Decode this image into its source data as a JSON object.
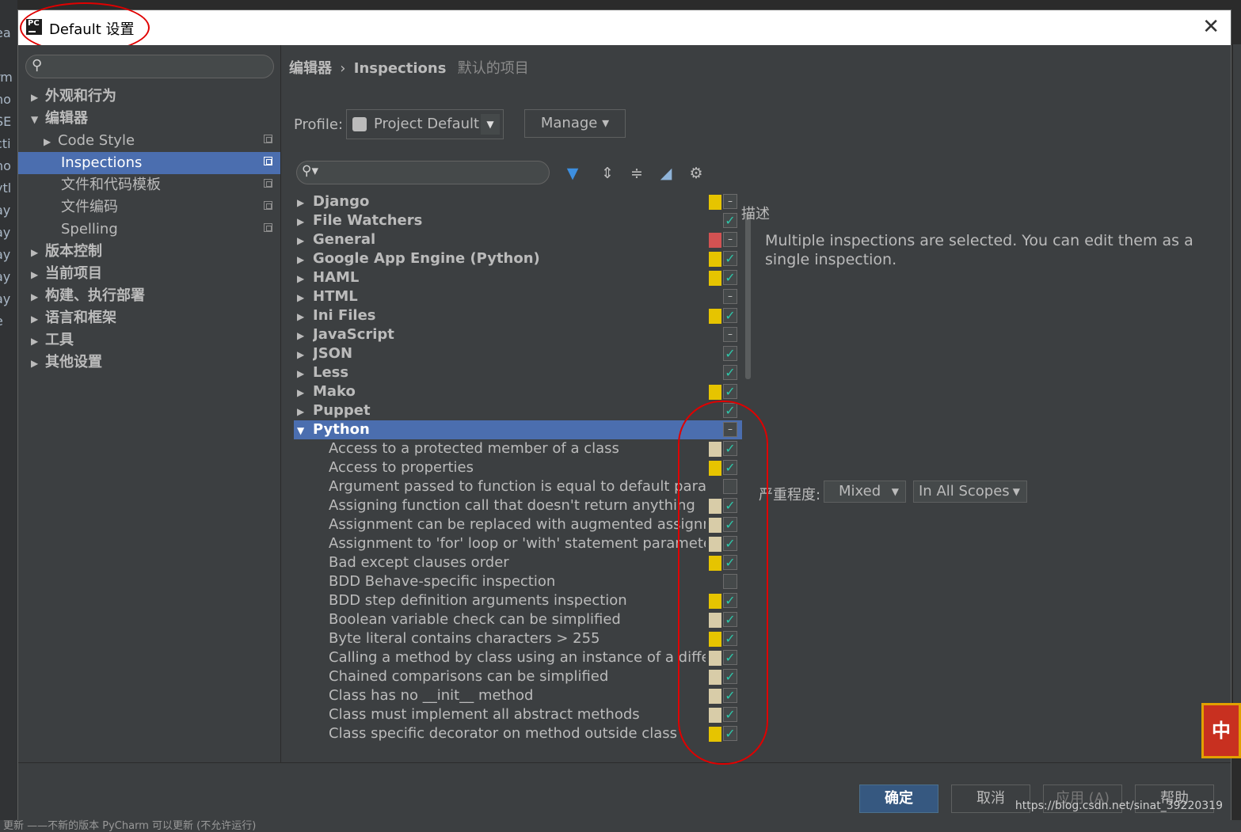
{
  "dialog": {
    "title": "Default 设置",
    "close": "✕"
  },
  "background_ide": {
    "left_strip": [
      ")",
      "ea",
      "",
      "rm",
      "ho",
      "SE",
      "cti",
      "ho",
      "ytl",
      "ay",
      "ay",
      "ay",
      "ay",
      "ay",
      "e"
    ],
    "bottom_text": "更新    ——不新的版本 PyCharm 可以更新 (不允许运行)"
  },
  "sidebar": {
    "search_placeholder": "",
    "items": [
      {
        "label": "外观和行为",
        "arrow": "▶",
        "level": 0,
        "bold": true
      },
      {
        "label": "编辑器",
        "arrow": "▼",
        "level": 0,
        "bold": true
      },
      {
        "label": "Code Style",
        "arrow": "▶",
        "level": 1,
        "bold": false,
        "copy": true
      },
      {
        "label": "Inspections",
        "arrow": "",
        "level": 1,
        "bold": false,
        "copy": true,
        "selected": true
      },
      {
        "label": "文件和代码模板",
        "arrow": "",
        "level": 1,
        "bold": false,
        "copy": true
      },
      {
        "label": "文件编码",
        "arrow": "",
        "level": 1,
        "bold": false,
        "copy": true
      },
      {
        "label": "Spelling",
        "arrow": "",
        "level": 1,
        "bold": false,
        "copy": true
      },
      {
        "label": "版本控制",
        "arrow": "▶",
        "level": 0,
        "bold": true
      },
      {
        "label": "当前项目",
        "arrow": "▶",
        "level": 0,
        "bold": true
      },
      {
        "label": "构建、执行部署",
        "arrow": "▶",
        "level": 0,
        "bold": true
      },
      {
        "label": "语言和框架",
        "arrow": "▶",
        "level": 0,
        "bold": true
      },
      {
        "label": "工具",
        "arrow": "▶",
        "level": 0,
        "bold": true
      },
      {
        "label": "其他设置",
        "arrow": "▶",
        "level": 0,
        "bold": true
      }
    ]
  },
  "breadcrumb": {
    "root": "编辑器",
    "sep": "›",
    "current": "Inspections",
    "scope_note": "默认的项目"
  },
  "profile": {
    "label": "Profile:",
    "value": "Project Default",
    "manage": "Manage ▾"
  },
  "inspections": [
    {
      "name": "Django",
      "group": true,
      "arrow": "▶",
      "sev": "#e6c400",
      "check": "dash"
    },
    {
      "name": "File Watchers",
      "group": true,
      "arrow": "▶",
      "sev": "",
      "check": "on"
    },
    {
      "name": "General",
      "group": true,
      "arrow": "▶",
      "sev": "#d25252",
      "check": "dash"
    },
    {
      "name": "Google App Engine (Python)",
      "group": true,
      "arrow": "▶",
      "sev": "#e6c400",
      "check": "on"
    },
    {
      "name": "HAML",
      "group": true,
      "arrow": "▶",
      "sev": "#e6c400",
      "check": "on"
    },
    {
      "name": "HTML",
      "group": true,
      "arrow": "▶",
      "sev": "",
      "check": "dash"
    },
    {
      "name": "Ini Files",
      "group": true,
      "arrow": "▶",
      "sev": "#e6c400",
      "check": "on"
    },
    {
      "name": "JavaScript",
      "group": true,
      "arrow": "▶",
      "sev": "",
      "check": "dash"
    },
    {
      "name": "JSON",
      "group": true,
      "arrow": "▶",
      "sev": "",
      "check": "on"
    },
    {
      "name": "Less",
      "group": true,
      "arrow": "▶",
      "sev": "",
      "check": "on"
    },
    {
      "name": "Mako",
      "group": true,
      "arrow": "▶",
      "sev": "#e6c400",
      "check": "on"
    },
    {
      "name": "Puppet",
      "group": true,
      "arrow": "▶",
      "sev": "",
      "check": "on"
    },
    {
      "name": "Python",
      "group": true,
      "arrow": "▼",
      "sev": "",
      "check": "dash",
      "selected": true
    },
    {
      "name": "Access to a protected member of a class",
      "group": false,
      "sev": "#d8cca8",
      "check": "on"
    },
    {
      "name": "Access to properties",
      "group": false,
      "sev": "#e6c400",
      "check": "on"
    },
    {
      "name": "Argument passed to function is equal to default parame",
      "group": false,
      "sev": "",
      "check": "off"
    },
    {
      "name": "Assigning function call that doesn't return anything",
      "group": false,
      "sev": "#d8cca8",
      "check": "on"
    },
    {
      "name": "Assignment can be replaced with augmented assignme",
      "group": false,
      "sev": "#d8cca8",
      "check": "on"
    },
    {
      "name": "Assignment to 'for' loop or 'with' statement parameter",
      "group": false,
      "sev": "#d8cca8",
      "check": "on"
    },
    {
      "name": "Bad except clauses order",
      "group": false,
      "sev": "#e6c400",
      "check": "on"
    },
    {
      "name": "BDD Behave-specific inspection",
      "group": false,
      "sev": "",
      "check": "off"
    },
    {
      "name": "BDD step definition arguments inspection",
      "group": false,
      "sev": "#e6c400",
      "check": "on"
    },
    {
      "name": "Boolean variable check can be simplified",
      "group": false,
      "sev": "#d8cca8",
      "check": "on"
    },
    {
      "name": "Byte literal contains characters > 255",
      "group": false,
      "sev": "#e6c400",
      "check": "on"
    },
    {
      "name": "Calling a method by class using an instance of a differer",
      "group": false,
      "sev": "#d8cca8",
      "check": "on"
    },
    {
      "name": "Chained comparisons can be simplified",
      "group": false,
      "sev": "#d8cca8",
      "check": "on"
    },
    {
      "name": "Class has no __init__ method",
      "group": false,
      "sev": "#d8cca8",
      "check": "on"
    },
    {
      "name": "Class must implement all abstract methods",
      "group": false,
      "sev": "#d8cca8",
      "check": "on"
    },
    {
      "name": "Class specific decorator on method outside class",
      "group": false,
      "sev": "#e6c400",
      "check": "on"
    }
  ],
  "description": {
    "label": "描述",
    "text": "Multiple inspections are selected. You can edit them as a single inspection."
  },
  "severity": {
    "label": "严重程度:",
    "value": "Mixed",
    "scope": "In All Scopes"
  },
  "footer": {
    "ok": "确定",
    "cancel": "取消",
    "apply": "应用 (A)",
    "help": "帮助",
    "watermark": "https://blog.csdn.net/sinat_39220319"
  },
  "colors": {
    "selection": "#4b6eaf",
    "severity_warning": "#e6c400",
    "severity_error": "#d25252",
    "severity_weak": "#d8cca8",
    "check": "#2ec6a9",
    "annotation": "#e00000"
  },
  "icons": [
    "search-icon",
    "filter-icon",
    "expand-all-icon",
    "collapse-all-icon",
    "eraser-icon",
    "gear-icon",
    "close-icon",
    "checkmark-icon"
  ]
}
